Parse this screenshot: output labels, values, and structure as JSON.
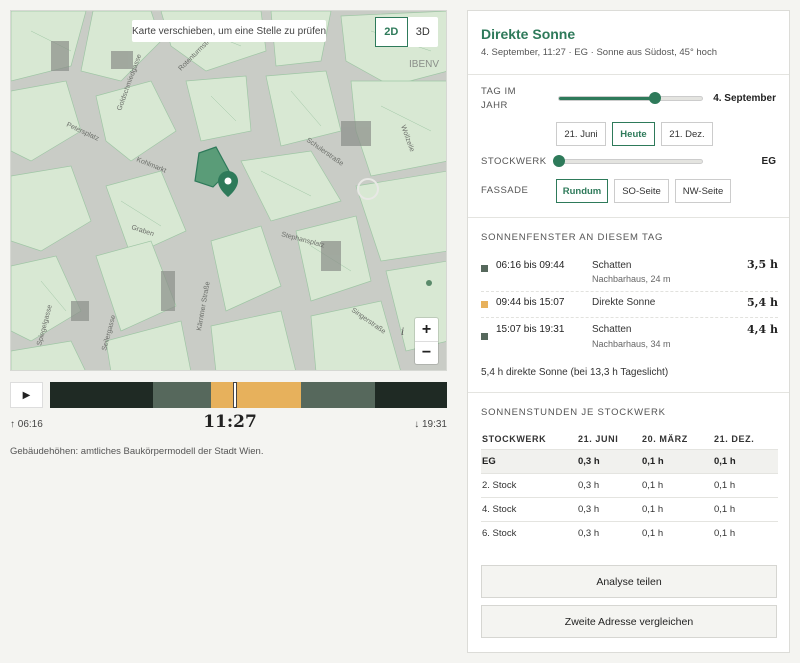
{
  "map": {
    "hint": "Karte verschieben, um eine Stelle zu prüfen",
    "view_2d": "2D",
    "view_3d": "3D",
    "zoom_in": "+",
    "zoom_out": "−",
    "info": "i",
    "street_labels": [
      "Petersplatz",
      "Graben",
      "Kohlmarkt",
      "Stephansplatz",
      "Kärntner Straße",
      "Schulerstraße",
      "Goldschmiedgasse",
      "Spiegelgasse",
      "Wollzeile",
      "Rotenturmstraße",
      "Singerstraße",
      "Seilergasse",
      "IBENV"
    ]
  },
  "timeline": {
    "play": "▶",
    "start": "↑ 06:16",
    "now": "11:27",
    "end": "↓ 19:31",
    "current_fraction": 0.465,
    "segments": [
      {
        "from": 0.0,
        "to": 0.26,
        "color": "#1f2a24"
      },
      {
        "from": 0.26,
        "to": 0.405,
        "color": "#56685c"
      },
      {
        "from": 0.405,
        "to": 0.633,
        "color": "#e7b15c"
      },
      {
        "from": 0.633,
        "to": 0.818,
        "color": "#56685c"
      },
      {
        "from": 0.818,
        "to": 1.0,
        "color": "#1f2a24"
      }
    ]
  },
  "source": "Gebäudehöhen: amtliches Baukörpermodell der Stadt Wien.",
  "panel": {
    "title": "Direkte Sonne",
    "subtitle": "4. September, 11:27 · EG · Sonne aus Südost, 45° hoch",
    "day_label": "Tag im Jahr",
    "day_value": "4. September",
    "day_fraction": 0.67,
    "day_buttons": [
      "21. Juni",
      "Heute",
      "21. Dez."
    ],
    "floor_label": "Stockwerk",
    "floor_value": "EG",
    "floor_fraction": 0.0,
    "facade_label": "Fassade",
    "facade_buttons": [
      "Rundum",
      "SO-Seite",
      "NW-Seite"
    ],
    "windows_title": "Sonnenfenster an diesem Tag",
    "windows": [
      {
        "time": "06:16 bis 09:44",
        "kind": "Schatten",
        "note": "Nachbarhaus, 24 m",
        "dur": "3,5 h",
        "color": "#56685c"
      },
      {
        "time": "09:44 bis 15:07",
        "kind": "Direkte Sonne",
        "note": "",
        "dur": "5,4 h",
        "color": "#e7b15c"
      },
      {
        "time": "15:07 bis 19:31",
        "kind": "Schatten",
        "note": "Nachbarhaus, 34 m",
        "dur": "4,4 h",
        "color": "#56685c"
      }
    ],
    "summary": "5,4 h direkte Sonne (bei 13,3 h Tageslicht)",
    "hours_title": "Sonnenstunden je Stockwerk",
    "table": {
      "headers": [
        "STOCKWERK",
        "21. JUNI",
        "20. MÄRZ",
        "21. DEZ."
      ],
      "rows": [
        [
          "EG",
          "0,3 h",
          "0,1 h",
          "0,1 h"
        ],
        [
          "2. Stock",
          "0,3 h",
          "0,1 h",
          "0,1 h"
        ],
        [
          "4. Stock",
          "0,3 h",
          "0,1 h",
          "0,1 h"
        ],
        [
          "6. Stock",
          "0,3 h",
          "0,1 h",
          "0,1 h"
        ]
      ]
    },
    "share_button": "Analyse teilen",
    "compare_button": "Zweite Adresse vergleichen"
  }
}
